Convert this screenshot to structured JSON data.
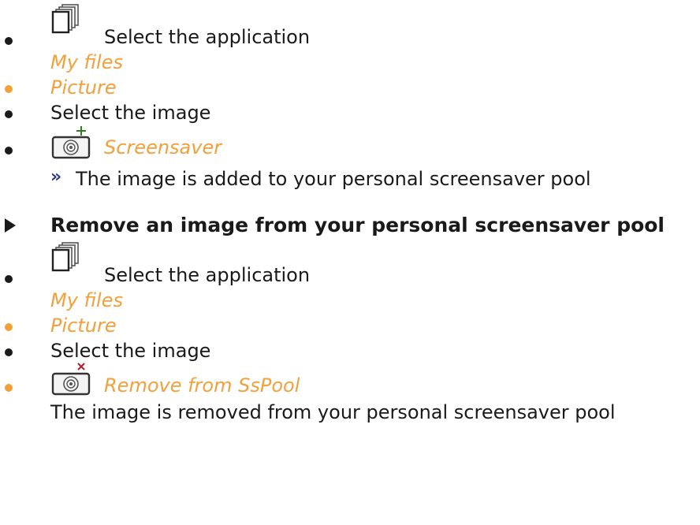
{
  "section_add": {
    "step1_label": "Select the application",
    "step1_sub": "My files",
    "step2": "Picture",
    "step3": "Select the image",
    "step4": "Screensaver",
    "result_marker": "››",
    "result": "The image is added to your personal screensaver pool"
  },
  "section_remove": {
    "heading": "Remove an image from your personal screensaver pool",
    "step1_label": "Select the application",
    "step1_sub": "My files",
    "step2": "Picture",
    "step3": "Select the image",
    "step4": "Remove from SsPool",
    "result": "The image is removed from your personal screensaver pool"
  },
  "colors": {
    "accent": "#f2a03a",
    "marker": "#2b3a8e",
    "text": "#1a1a1a"
  },
  "icons": [
    "files-stack-icon",
    "add-screensaver-icon",
    "remove-screensaver-icon"
  ]
}
